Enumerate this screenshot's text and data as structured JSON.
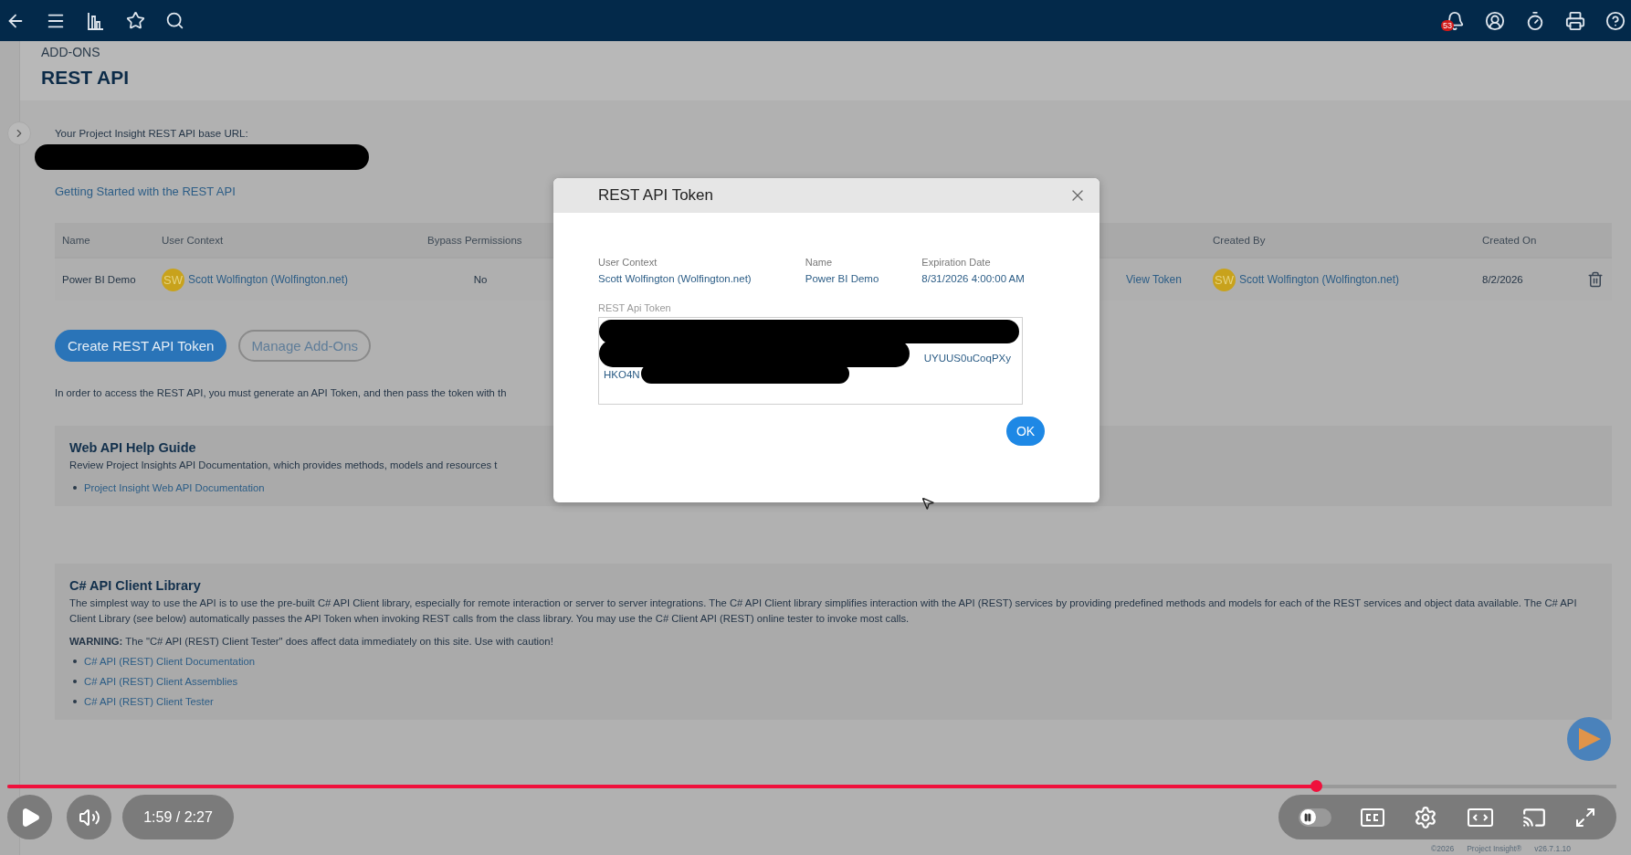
{
  "top_bar": {
    "notification_count": "53"
  },
  "breadcrumb": "ADD-ONS",
  "page_title": "REST API",
  "base_url_label": "Your Project Insight REST API base URL:",
  "getting_started_link": "Getting Started with the REST API",
  "tokens_table": {
    "columns": [
      "Name",
      "User Context",
      "Bypass Permissions",
      "Created By",
      "Created On"
    ],
    "rows": [
      {
        "name": "Power BI Demo",
        "user_context": {
          "initials": "SW",
          "name": "Scott Wolfington (Wolfington.net)"
        },
        "bypass_permissions": "No",
        "action": "View Token",
        "created_by": {
          "initials": "SW",
          "name": "Scott Wolfington (Wolfington.net)"
        },
        "created_on": "8/2/2026"
      }
    ]
  },
  "buttons": [
    {
      "label": "Create REST API Token",
      "kind": "primary"
    },
    {
      "label": "Manage Add-Ons",
      "kind": "secondary"
    }
  ],
  "intro_text": "In order to access the REST API, you must generate an API Token, and then pass the token with th",
  "sections": [
    {
      "title": "Web API Help Guide",
      "description": "Review Project Insights API Documentation, which provides methods, models and resources t",
      "links": [
        "Project Insight Web API Documentation"
      ]
    },
    {
      "title": "C# API Client Library",
      "description": "The simplest way to use the API is to use the pre-built C# API Client library, especially for remote interaction or server to server integrations. The C# API Client library simplifies interaction with the API (REST) services by providing predefined methods and models for each of the REST services and object data available. The C# API Client Library (see below) automatically passes the API Token when invoking REST calls from the class library. You may use the C# Client API (REST) online tester to invoke most calls.",
      "warning": "**WARNING:** The \"C# API (REST) Client Tester\" does affect data immediately on this site. Use with caution!",
      "links": [
        "C# API (REST) Client Documentation",
        "C# API (REST) Client Assemblies",
        "C# API (REST) Client Tester"
      ]
    }
  ],
  "footer": [
    "©2026",
    "Project Insight®",
    "v26.7.1.10"
  ],
  "modal": {
    "title": "REST API Token",
    "fields": [
      {
        "label": "User Context",
        "value": "Scott Wolfington (Wolfington.net)"
      },
      {
        "label": "Name",
        "value": "Power BI Demo"
      },
      {
        "label": "Expiration Date",
        "value": "8/31/2026 4:00:00 AM"
      }
    ],
    "token_label": "REST Api Token",
    "token_fragments": [
      "UYUUS0uCoqPXy",
      "HKO4N"
    ],
    "ok_button": "OK"
  },
  "video_player": {
    "progress": {
      "level": 0.813
    },
    "time": "1:59 / 2:27",
    "autoplay": {
      "on": false
    }
  }
}
